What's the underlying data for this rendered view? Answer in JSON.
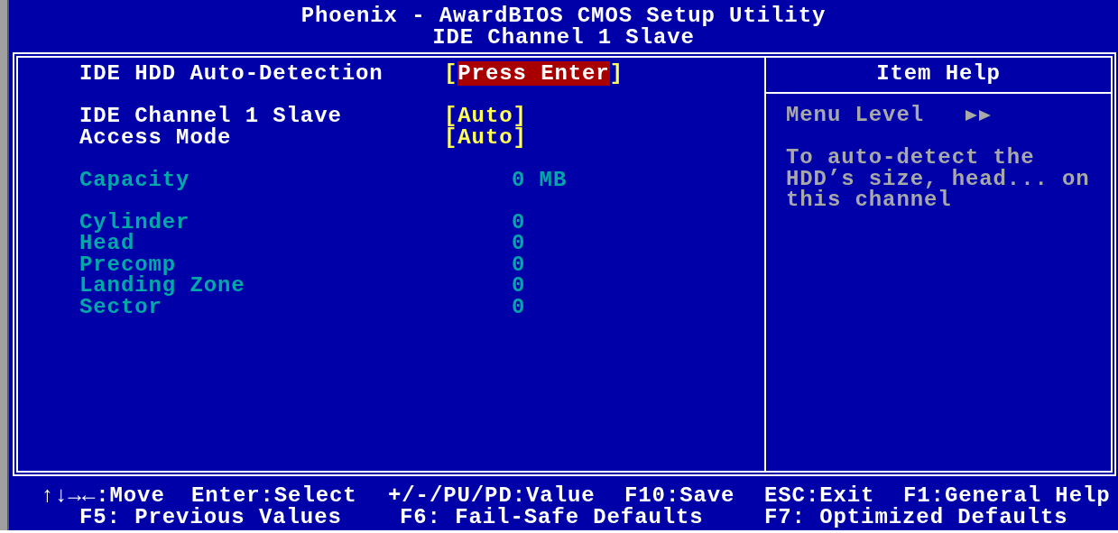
{
  "title": "Phoenix - AwardBIOS CMOS Setup Utility",
  "subtitle": "IDE Channel 1 Slave",
  "groups": [
    {
      "items": [
        {
          "kind": "option",
          "label": "IDE HDD Auto-Detection",
          "value": "[Press Enter]",
          "selected": true
        }
      ]
    },
    {
      "items": [
        {
          "kind": "option",
          "label": "IDE Channel 1 Slave",
          "value": "[Auto]",
          "selected": false
        },
        {
          "kind": "option",
          "label": "Access Mode",
          "value": "[Auto]",
          "selected": false
        }
      ]
    },
    {
      "items": [
        {
          "kind": "info",
          "label": "Capacity",
          "value": "0 MB"
        }
      ]
    },
    {
      "items": [
        {
          "kind": "info",
          "label": "Cylinder",
          "value": "0"
        },
        {
          "kind": "info",
          "label": "Head",
          "value": "0"
        },
        {
          "kind": "info",
          "label": "Precomp",
          "value": "0"
        },
        {
          "kind": "info",
          "label": "Landing Zone",
          "value": "0"
        },
        {
          "kind": "info",
          "label": "Sector",
          "value": "0"
        }
      ]
    }
  ],
  "help": {
    "title": "Item Help",
    "menu_level": "Menu Level",
    "text": "To auto-detect the HDD’s size, head... on this channel"
  },
  "footer": {
    "keys_line": [
      "↑↓→←:Move",
      "Enter:Select",
      "+/-/PU/PD:Value",
      "F10:Save",
      "ESC:Exit",
      "F1:General Help"
    ],
    "defaults_line": [
      "F5: Previous Values",
      "F6: Fail-Safe Defaults",
      "F7: Optimized Defaults"
    ]
  }
}
